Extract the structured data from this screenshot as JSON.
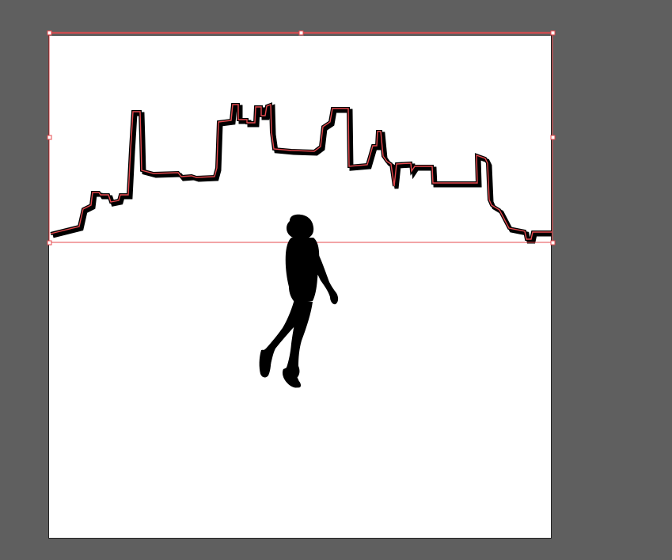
{
  "app": {
    "canvas_background": "#5f5f5f",
    "artboard_background": "#ffffff",
    "selection_color": "#e5484d",
    "shape_fill": "#000000"
  },
  "artwork": {
    "objects": [
      {
        "name": "skyline-outline",
        "selected": true
      },
      {
        "name": "person-silhouette",
        "selected": false
      }
    ]
  },
  "selection": {
    "handles": 8,
    "has_bounding_box": true
  }
}
